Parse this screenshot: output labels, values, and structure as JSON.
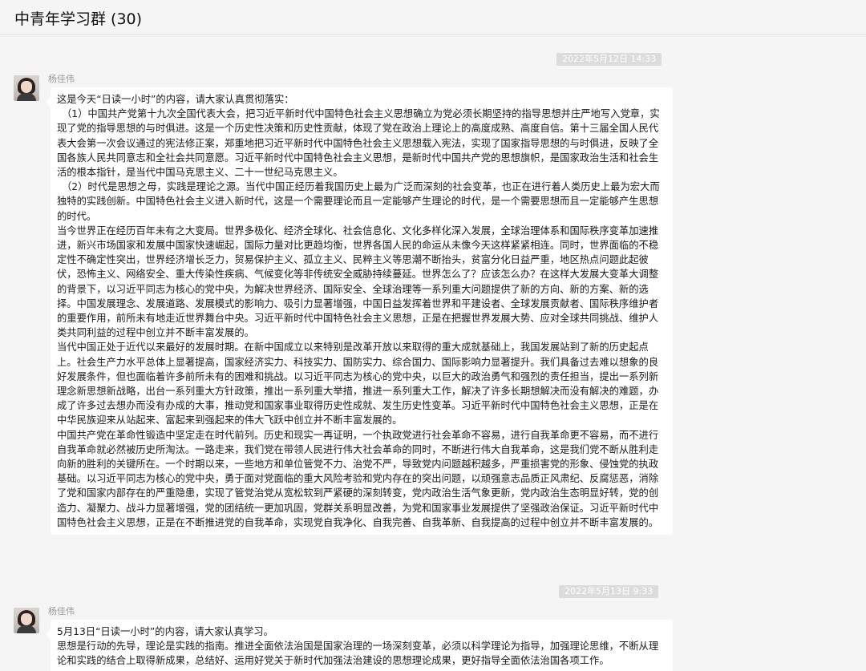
{
  "window": {
    "title": "中青年学习群 (30)"
  },
  "messages": [
    {
      "timestamp": "2022年5月12日 14:33",
      "sender": "杨佳伟",
      "paragraphs": [
        "这是今天“日读一小时”的内容，请大家认真贯彻落实：",
        "（1）中国共产党第十九次全国代表大会，把习近平新时代中国特色社会主义思想确立为党必须长期坚持的指导思想并庄严地写入党章，实现了党的指导思想的与时俱进。这是一个历史性决策和历史性贡献，体现了党在政治上理论上的高度成熟、高度自信。第十三届全国人民代表大会第一次会议通过的宪法修正案，郑重地把习近平新时代中国特色社会主义思想载入宪法，实现了国家指导思想的与时俱进，反映了全国各族人民共同意志和全社会共同意愿。习近平新时代中国特色社会主义思想，是新时代中国共产党的思想旗帜，是国家政治生活和社会生活的根本指针，是当代中国马克思主义、二十一世纪马克思主义。",
        "（2）时代是思想之母，实践是理论之源。当代中国正经历着我国历史上最为广泛而深刻的社会变革，也正在进行着人类历史上最为宏大而独特的实践创新。中国特色社会主义进入新时代，这是一个需要理论而且一定能够产生理论的时代，是一个需要思想而且一定能够产生思想的时代。",
        "当今世界正在经历百年未有之大变局。世界多极化、经济全球化、社会信息化、文化多样化深入发展，全球治理体系和国际秩序变革加速推进，新兴市场国家和发展中国家快速崛起，国际力量对比更趋均衡，世界各国人民的命运从未像今天这样紧紧相连。同时，世界面临的不稳定性不确定性突出，世界经济增长乏力，贸易保护主义、孤立主义、民粹主义等思潮不断抬头，贫富分化日益严重，地区热点问题此起彼伏，恐怖主义、网络安全、重大传染性疾病、气候变化等非传统安全威胁持续蔓延。世界怎么了？应该怎么办？在这样大发展大变革大调整的背景下，以习近平同志为核心的党中央，为解决世界经济、国际安全、全球治理等一系列重大问题提供了新的方向、新的方案、新的选择。中国发展理念、发展道路、发展模式的影响力、吸引力显著增强，中国日益发挥着世界和平建设者、全球发展贡献者、国际秩序维护者的重要作用，前所未有地走近世界舞台中央。习近平新时代中国特色社会主义思想，正是在把握世界发展大势、应对全球共同挑战、维护人类共同利益的过程中创立并不断丰富发展的。",
        "当代中国正处于近代以来最好的发展时期。在新中国成立以来特别是改革开放以来取得的重大成就基础上，我国发展站到了新的历史起点上。社会生产力水平总体上显著提高，国家经济实力、科技实力、国防实力、综合国力、国际影响力显著提升。我们具备过去难以想象的良好发展条件，但也面临着许多前所未有的困难和挑战。以习近平同志为核心的党中央，以巨大的政治勇气和强烈的责任担当，提出一系列新理念新思想新战略，出台一系列重大方针政策，推出一系列重大举措，推进一系列重大工作，解决了许多长期想解决而没有解决的难题，办成了许多过去想办而没有办成的大事，推动党和国家事业取得历史性成就、发生历史性变革。习近平新时代中国特色社会主义思想，正是在中华民族迎来从站起来、富起来到强起来的伟大飞跃中创立并不断丰富发展的。",
        "中国共产党在革命性锻造中坚定走在时代前列。历史和现实一再证明，一个执政党进行社会革命不容易，进行自我革命更不容易，而不进行自我革命就必然被历史所淘汰。一路走来，我们党在带领人民进行伟大社会革命的同时，不断进行伟大自我革命，这是我们党不断从胜利走向新的胜利的关键所在。一个时期以来，一些地方和单位管党不力、治党不严，导致党内问题越积越多，严重损害党的形象、侵蚀党的执政基础。以习近平同志为核心的党中央，勇于面对党面临的重大风险考验和党内存在的突出问题，以顽强意志品质正风肃纪、反腐惩恶，消除了党和国家内部存在的严重隐患，实现了管党治党从宽松软到严紧硬的深刻转变，党内政治生活气象更新，党内政治生态明显好转，党的创造力、凝聚力、战斗力显著增强，党的团结统一更加巩固，党群关系明显改善，为党和国家事业发展提供了坚强政治保证。习近平新时代中国特色社会主义思想，正是在不断推进党的自我革命，实现党自我净化、自我完善、自我革新、自我提高的过程中创立并不断丰富发展的。"
      ]
    },
    {
      "timestamp": "2022年5月13日 9:33",
      "sender": "杨佳伟",
      "paragraphs": [
        "5月13日“日读一小时”的内容，请大家认真学习。",
        "思想是行动的先导，理论是实践的指南。推进全面依法治国是国家治理的一场深刻变革，必须以科学理论为指导，加强理论思维，不断从理论和实践的结合上取得新成果，总结好、运用好党关于新时代加强法治建设的思想理论成果，更好指导全面依法治国各项工作。"
      ]
    }
  ]
}
